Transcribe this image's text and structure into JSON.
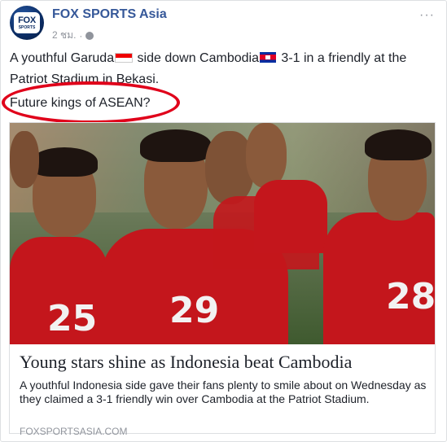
{
  "post": {
    "page_name": "FOX SPORTS Asia",
    "avatar": {
      "line1": "FOX",
      "line2": "SPORTS"
    },
    "time": "2 ชม.",
    "privacy_icon": "globe-icon",
    "more_icon": "more-options-icon",
    "more_label": "···",
    "text": {
      "part1": "A youthful Garuda",
      "part2": " side down Cambodia",
      "part3": " 3-1 in a friendly at the Patriot Stadium in Bekasi.",
      "line2": "Future kings of ASEAN?"
    },
    "annotation_color": "#e0001a"
  },
  "link": {
    "title": "Young stars shine as Indonesia beat Cambodia",
    "description": "A youthful Indonesia side gave their fans plenty to smile about on Wednesday as they claimed a 3-1 friendly win over Cambodia at the Patriot Stadium.",
    "domain": "FOXSPORTSASIA.COM",
    "jersey_numbers": [
      "25",
      "29",
      "28"
    ]
  },
  "colors": {
    "page_name": "#365899",
    "meta": "#90949c",
    "jersey": "#c4161c"
  }
}
